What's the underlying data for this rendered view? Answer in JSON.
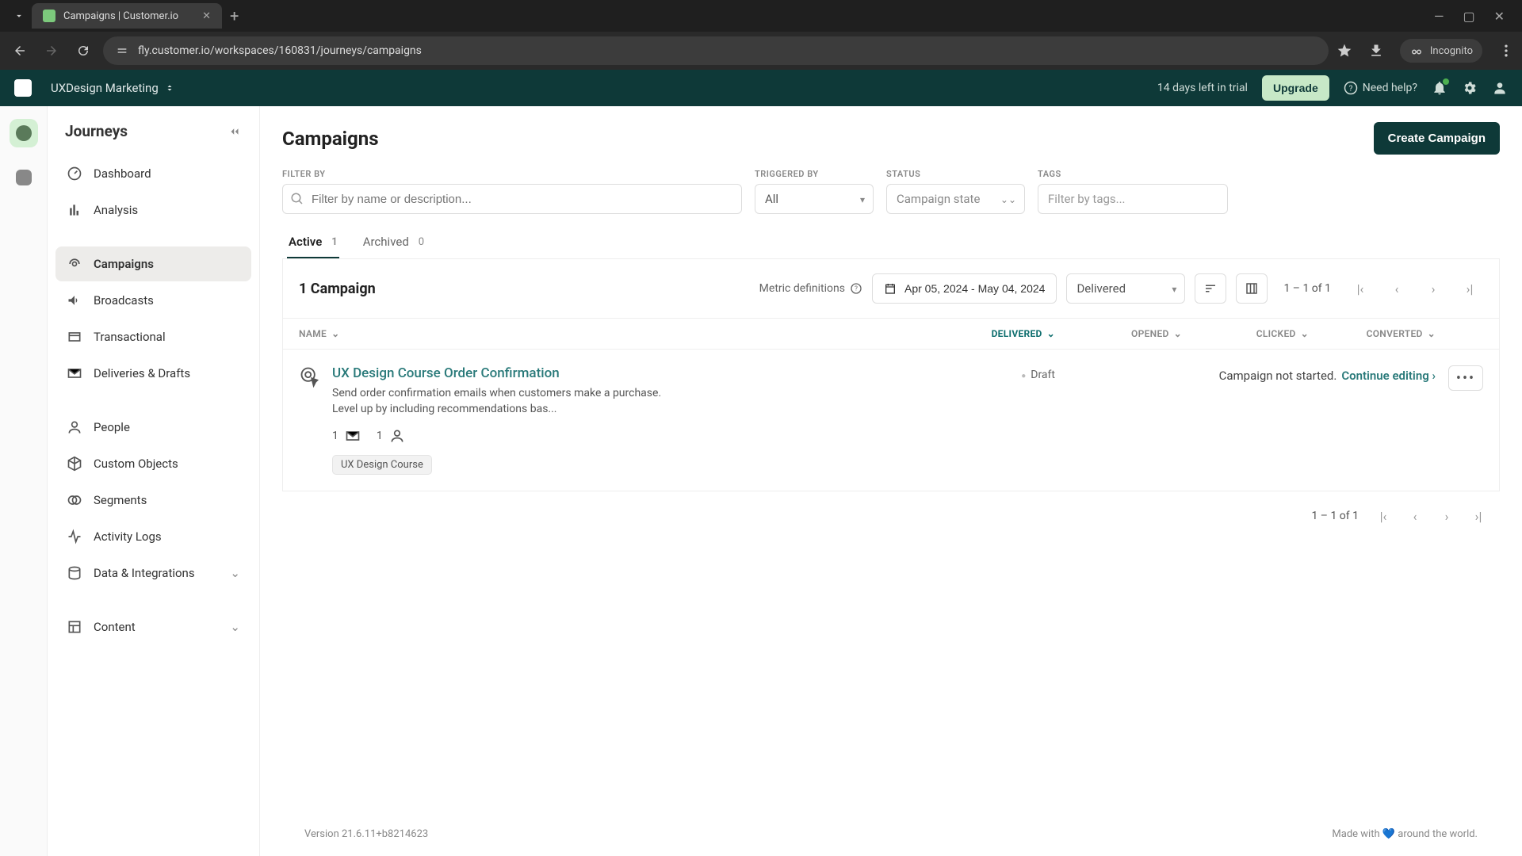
{
  "browser": {
    "tab_title": "Campaigns | Customer.io",
    "url": "fly.customer.io/workspaces/160831/journeys/campaigns",
    "incognito": "Incognito"
  },
  "header": {
    "workspace": "UXDesign Marketing",
    "trial": "14 days left in trial",
    "upgrade": "Upgrade",
    "help": "Need help?"
  },
  "sidebar": {
    "title": "Journeys",
    "items": {
      "dashboard": "Dashboard",
      "analysis": "Analysis",
      "campaigns": "Campaigns",
      "broadcasts": "Broadcasts",
      "transactional": "Transactional",
      "deliveries": "Deliveries & Drafts",
      "people": "People",
      "custom_objects": "Custom Objects",
      "segments": "Segments",
      "activity_logs": "Activity Logs",
      "data_integrations": "Data & Integrations",
      "content": "Content"
    }
  },
  "page": {
    "title": "Campaigns",
    "create_btn": "Create Campaign"
  },
  "filters": {
    "filter_by_label": "FILTER BY",
    "filter_placeholder": "Filter by name or description...",
    "triggered_by_label": "TRIGGERED BY",
    "triggered_by_value": "All",
    "status_label": "STATUS",
    "status_value": "Campaign state",
    "tags_label": "TAGS",
    "tags_placeholder": "Filter by tags..."
  },
  "tabs": {
    "active": "Active",
    "active_count": "1",
    "archived": "Archived",
    "archived_count": "0"
  },
  "toolbar": {
    "count_text": "1 Campaign",
    "metric_def": "Metric definitions",
    "date_range": "Apr 05, 2024 - May 04, 2024",
    "metric_select": "Delivered",
    "pagination": "1 – 1 of 1"
  },
  "columns": {
    "name": "NAME",
    "delivered": "DELIVERED",
    "opened": "OPENED",
    "clicked": "CLICKED",
    "converted": "CONVERTED"
  },
  "campaigns": [
    {
      "title": "UX Design Course Order Confirmation",
      "desc": "Send order confirmation emails when customers make a purchase. Level up by including recommendations bas...",
      "status": "Draft",
      "messages": "1",
      "people": "1",
      "tag": "UX Design Course",
      "not_started": "Campaign not started.",
      "continue": "Continue editing"
    }
  ],
  "footer": {
    "version": "Version 21.6.11+b8214623",
    "made_with": "Made with",
    "around": "around the world."
  }
}
